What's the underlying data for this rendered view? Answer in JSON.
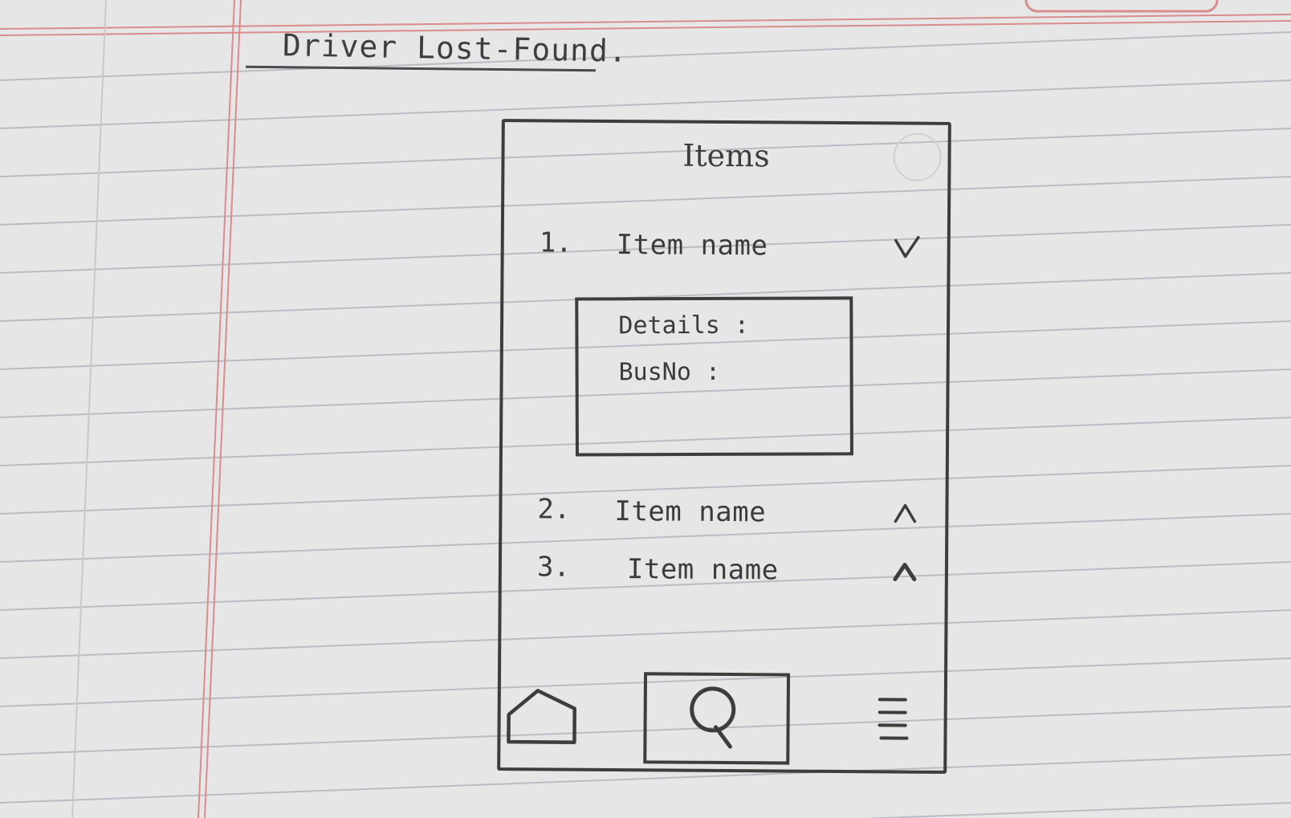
{
  "page": {
    "heading": "Driver Lost-Found."
  },
  "screen": {
    "title": "Items",
    "items": [
      {
        "number": "1.",
        "name": "Item name",
        "expanded": true,
        "chevron": "chevron-down-icon"
      },
      {
        "number": "2.",
        "name": "Item name",
        "expanded": false,
        "chevron": "chevron-up-icon"
      },
      {
        "number": "3.",
        "name": "Item name",
        "expanded": false,
        "chevron": "chevron-up-icon"
      }
    ],
    "details": {
      "details_label": "Details :",
      "bus_label": "BusNo :"
    },
    "nav": [
      {
        "name": "home",
        "icon": "home-icon"
      },
      {
        "name": "search",
        "icon": "search-icon",
        "active": true
      },
      {
        "name": "menu",
        "icon": "menu-icon"
      }
    ]
  },
  "colors": {
    "paper": "#e6e6e7",
    "rule_line": "#b9bcc4",
    "margin_line": "#d98c8c",
    "pencil": "#3c3e3e"
  }
}
